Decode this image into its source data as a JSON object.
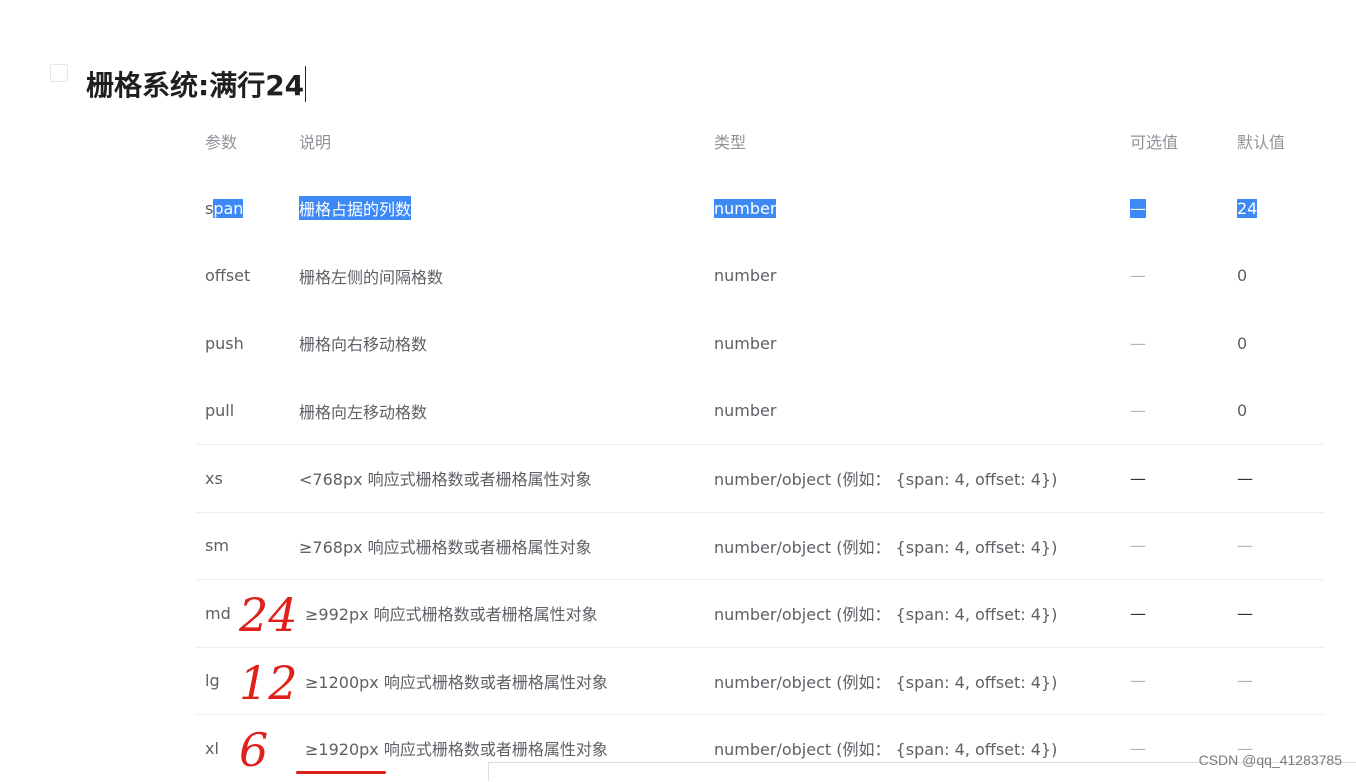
{
  "title": "栅格系统:满行24",
  "table": {
    "headers": {
      "param": "参数",
      "desc": "说明",
      "type": "类型",
      "options": "可选值",
      "default": "默认值"
    },
    "rows": [
      {
        "param_a": "s",
        "param_b": "pan",
        "desc": "栅格占据的列数",
        "type": "number",
        "options": "—",
        "default": "24"
      },
      {
        "param": "offset",
        "desc": "栅格左侧的间隔格数",
        "type": "number",
        "options": "—",
        "default": "0"
      },
      {
        "param": "push",
        "desc": "栅格向右移动格数",
        "type": "number",
        "options": "—",
        "default": "0"
      },
      {
        "param": "pull",
        "desc": "栅格向左移动格数",
        "type": "number",
        "options": "—",
        "default": "0"
      },
      {
        "param": "xs",
        "desc": "<768px 响应式栅格数或者栅格属性对象",
        "type": "number/object (例如： {span: 4, offset: 4})",
        "options": "—",
        "default": "—"
      },
      {
        "param": "sm",
        "desc": "≥768px 响应式栅格数或者栅格属性对象",
        "type": "number/object (例如： {span: 4, offset: 4})",
        "options": "—",
        "default": "—"
      },
      {
        "param": "md",
        "desc": "≥992px 响应式栅格数或者栅格属性对象",
        "type": "number/object (例如： {span: 4, offset: 4})",
        "options": "—",
        "default": "—",
        "annotation": "24"
      },
      {
        "param": "lg",
        "desc": "≥1200px 响应式栅格数或者栅格属性对象",
        "type": "number/object (例如： {span: 4, offset: 4})",
        "options": "—",
        "default": "—",
        "annotation": "12"
      },
      {
        "param": "xl",
        "desc": "≥1920px 响应式栅格数或者栅格属性对象",
        "type": "number/object (例如： {span: 4, offset: 4})",
        "options": "—",
        "default": "—",
        "annotation": "6"
      }
    ]
  },
  "watermark": "CSDN @qq_41283785",
  "colors": {
    "selection": "#3d8af7",
    "annotation": "#e0201b"
  }
}
